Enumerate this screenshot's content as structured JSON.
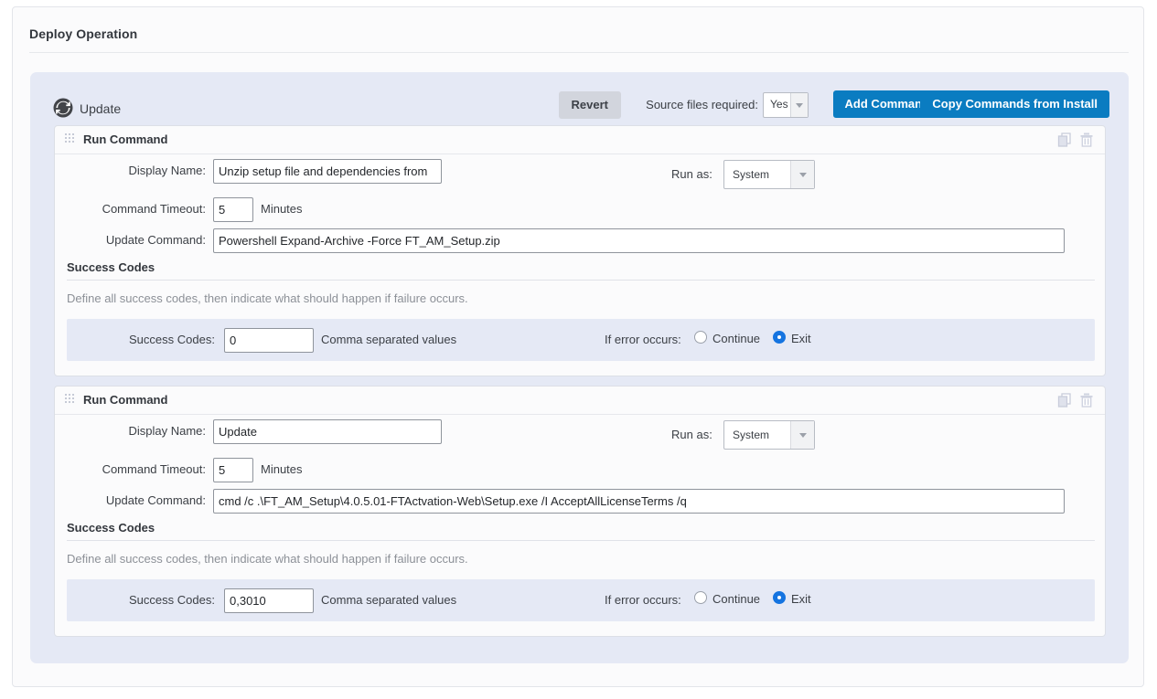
{
  "page": {
    "title": "Deploy Operation"
  },
  "operation": {
    "icon": "update-sync-icon",
    "name": "Update",
    "toolbar": {
      "revert_label": "Revert",
      "source_files_label": "Source files required:",
      "source_files_value": "Yes",
      "add_command_label": "Add Command",
      "copy_commands_label": "Copy Commands from Install"
    }
  },
  "labels": {
    "display_name": "Display Name:",
    "command_timeout": "Command Timeout:",
    "update_command": "Update Command:",
    "minutes": "Minutes",
    "run_as": "Run as:",
    "success_codes_title": "Success Codes",
    "success_codes_desc": "Define all success codes, then indicate what should happen if failure occurs.",
    "success_codes_label": "Success Codes:",
    "comma_hint": "Comma separated values",
    "if_error_label": "If error occurs:",
    "continue_label": "Continue",
    "exit_label": "Exit",
    "copy_icon": "copy-icon",
    "delete_icon": "trash-icon",
    "drag_icon": "drag-handle-icon"
  },
  "commands": [
    {
      "header": "Run Command",
      "display_name": "Unzip setup file and dependencies from",
      "timeout": "5",
      "command": "Powershell Expand-Archive -Force FT_AM_Setup.zip",
      "run_as": "System",
      "success_codes": "0",
      "on_error": "Exit"
    },
    {
      "header": "Run Command",
      "display_name": "Update",
      "timeout": "5",
      "command": "cmd /c .\\FT_AM_Setup\\4.0.5.01-FTActvation-Web\\Setup.exe /I AcceptAllLicenseTerms /q",
      "run_as": "System",
      "success_codes": "0,3010",
      "on_error": "Exit"
    }
  ],
  "colors": {
    "accent": "#0a7cc1",
    "panel": "#e5e9f5",
    "radio_selected": "#1574e0"
  }
}
